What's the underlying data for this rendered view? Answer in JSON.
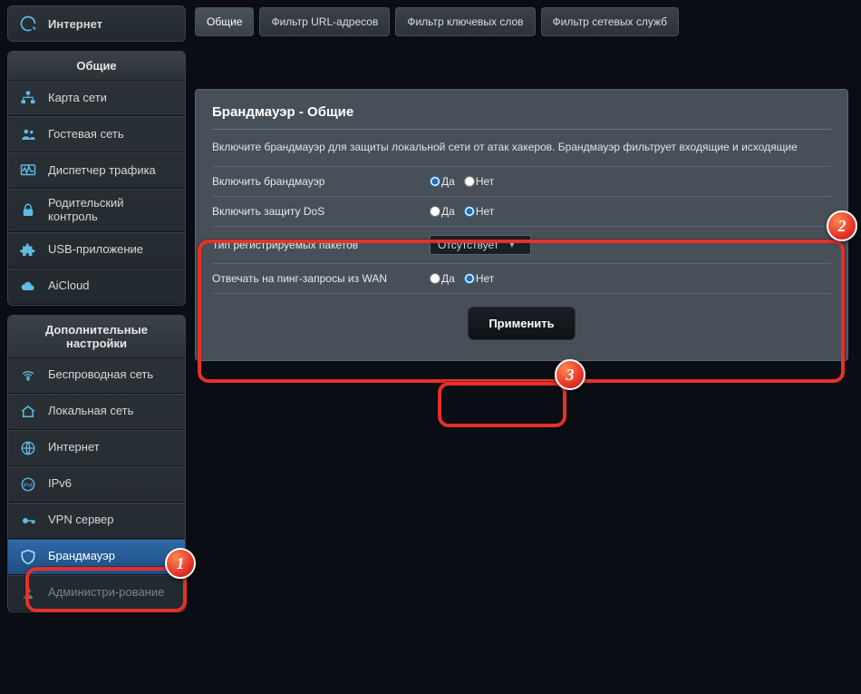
{
  "sidebar": {
    "internet_label": "Интернет",
    "general_header": "Общие",
    "advanced_header": "Дополнительные настройки",
    "general_items": [
      {
        "label": "Карта сети"
      },
      {
        "label": "Гостевая сеть"
      },
      {
        "label": "Диспетчер трафика"
      },
      {
        "label": "Родительский контроль"
      },
      {
        "label": "USB-приложение"
      },
      {
        "label": "AiCloud"
      }
    ],
    "advanced_items": [
      {
        "label": "Беспроводная сеть"
      },
      {
        "label": "Локальная сеть"
      },
      {
        "label": "Интернет"
      },
      {
        "label": "IPv6"
      },
      {
        "label": "VPN сервер"
      },
      {
        "label": "Брандмауэр"
      },
      {
        "label": "Администри-рование"
      }
    ]
  },
  "tabs": [
    {
      "label": "Общие"
    },
    {
      "label": "Фильтр URL-адресов"
    },
    {
      "label": "Фильтр ключевых слов"
    },
    {
      "label": "Фильтр сетевых служб"
    }
  ],
  "panel": {
    "title": "Брандмауэр - Общие",
    "description": "Включите брандмауэр для защиты локальной сети от атак хакеров. Брандмауэр фильтрует входящие и исходящие",
    "yes": "Да",
    "no": "Нет",
    "rows": {
      "enable_firewall": "Включить брандмауэр",
      "enable_dos": "Включить защиту DoS",
      "log_type": "Тип регистрируемых пакетов",
      "log_type_value": "Отсутствует",
      "respond_wan_ping": "Отвечать на пинг-запросы из WAN"
    },
    "apply": "Применить"
  },
  "callouts": {
    "one": "1",
    "two": "2",
    "three": "3"
  }
}
